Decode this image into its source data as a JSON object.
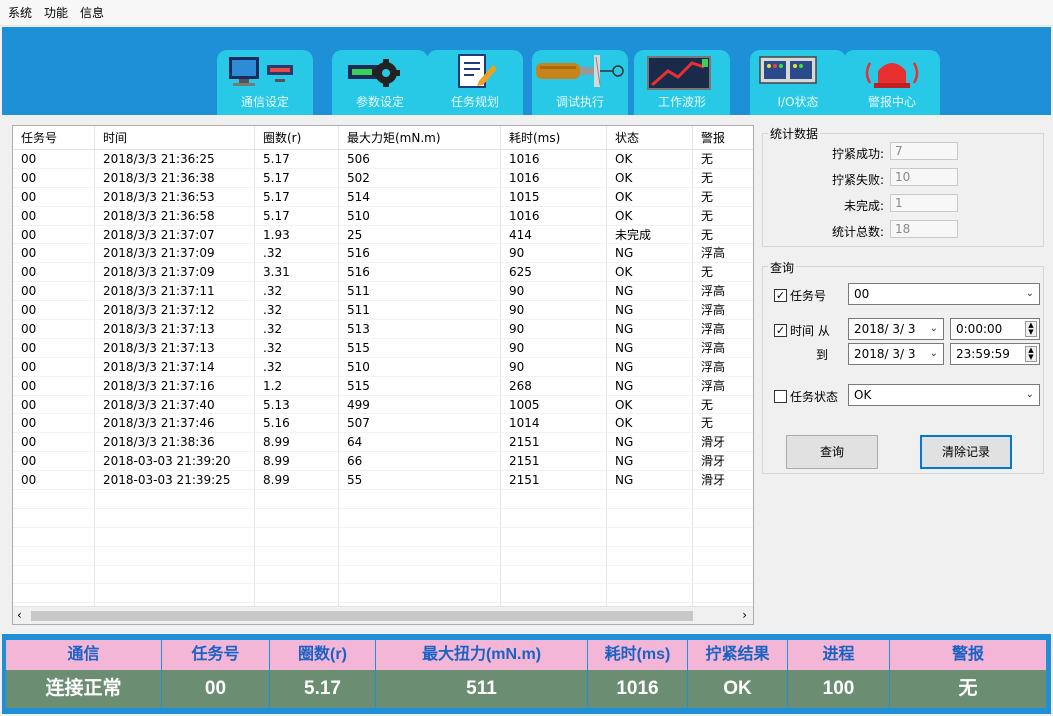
{
  "menu": [
    "系统",
    "功能",
    "信息"
  ],
  "tabs": [
    {
      "label": "通信设定",
      "icon": "monitor-icon"
    },
    {
      "label": "参数设定",
      "icon": "gear-battery-icon"
    },
    {
      "label": "任务规划",
      "icon": "document-edit-icon"
    },
    {
      "label": "调试执行",
      "icon": "screwdriver-icon"
    },
    {
      "label": "工作波形",
      "icon": "chart-waveform-icon"
    },
    {
      "label": "I/O状态",
      "icon": "io-panel-icon"
    },
    {
      "label": "警报中心",
      "icon": "alarm-icon"
    }
  ],
  "table": {
    "columns": [
      "任务号",
      "时间",
      "圈数(r)",
      "最大力矩(mN.m)",
      "耗时(ms)",
      "状态",
      "警报"
    ],
    "rows": [
      [
        "00",
        "2018/3/3 21:36:25",
        "5.17",
        "506",
        "1016",
        "OK",
        "无"
      ],
      [
        "00",
        "2018/3/3 21:36:38",
        "5.17",
        "502",
        "1016",
        "OK",
        "无"
      ],
      [
        "00",
        "2018/3/3 21:36:53",
        "5.17",
        "514",
        "1015",
        "OK",
        "无"
      ],
      [
        "00",
        "2018/3/3 21:36:58",
        "5.17",
        "510",
        "1016",
        "OK",
        "无"
      ],
      [
        "00",
        "2018/3/3 21:37:07",
        "1.93",
        "25",
        "414",
        "未完成",
        "无"
      ],
      [
        "00",
        "2018/3/3 21:37:09",
        ".32",
        "516",
        "90",
        "NG",
        "浮高"
      ],
      [
        "00",
        "2018/3/3 21:37:09",
        "3.31",
        "516",
        "625",
        "OK",
        "无"
      ],
      [
        "00",
        "2018/3/3 21:37:11",
        ".32",
        "511",
        "90",
        "NG",
        "浮高"
      ],
      [
        "00",
        "2018/3/3 21:37:12",
        ".32",
        "511",
        "90",
        "NG",
        "浮高"
      ],
      [
        "00",
        "2018/3/3 21:37:13",
        ".32",
        "513",
        "90",
        "NG",
        "浮高"
      ],
      [
        "00",
        "2018/3/3 21:37:13",
        ".32",
        "515",
        "90",
        "NG",
        "浮高"
      ],
      [
        "00",
        "2018/3/3 21:37:14",
        ".32",
        "510",
        "90",
        "NG",
        "浮高"
      ],
      [
        "00",
        "2018/3/3 21:37:16",
        "1.2",
        "515",
        "268",
        "NG",
        "浮高"
      ],
      [
        "00",
        "2018/3/3 21:37:40",
        "5.13",
        "499",
        "1005",
        "OK",
        "无"
      ],
      [
        "00",
        "2018/3/3 21:37:46",
        "5.16",
        "507",
        "1014",
        "OK",
        "无"
      ],
      [
        "00",
        "2018/3/3 21:38:36",
        "8.99",
        "64",
        "2151",
        "NG",
        "滑牙"
      ],
      [
        "00",
        "2018-03-03 21:39:20",
        "8.99",
        "66",
        "2151",
        "NG",
        "滑牙"
      ],
      [
        "00",
        "2018-03-03 21:39:25",
        "8.99",
        "55",
        "2151",
        "NG",
        "滑牙"
      ]
    ]
  },
  "stats": {
    "title": "统计数据",
    "success_label": "拧紧成功:",
    "success_value": "7",
    "fail_label": "拧紧失败:",
    "fail_value": "10",
    "incomplete_label": "未完成:",
    "incomplete_value": "1",
    "total_label": "统计总数:",
    "total_value": "18"
  },
  "query": {
    "title": "查询",
    "task_label": "任务号",
    "task_value": "00",
    "time_from_label": "时间 从",
    "from_date": "2018/ 3/ 3",
    "from_time": "0:00:00",
    "time_to_label": "到",
    "to_date": "2018/ 3/ 3",
    "to_time": "23:59:59",
    "status_label": "任务状态",
    "status_value": "OK",
    "query_button": "查询",
    "clear_button": "清除记录"
  },
  "status_bar": {
    "headers": [
      "通信",
      "任务号",
      "圈数(r)",
      "最大扭力(mN.m)",
      "耗时(ms)",
      "拧紧结果",
      "进程",
      "警报"
    ],
    "values": [
      "连接正常",
      "00",
      "5.17",
      "511",
      "1016",
      "OK",
      "100",
      "无"
    ]
  },
  "colors": {
    "banner": "#1e90d8",
    "tab": "#27c9e6",
    "status_header_bg": "#f4b6d6",
    "status_header_text": "#1a62c4",
    "status_value_bg": "#6b8e72"
  }
}
